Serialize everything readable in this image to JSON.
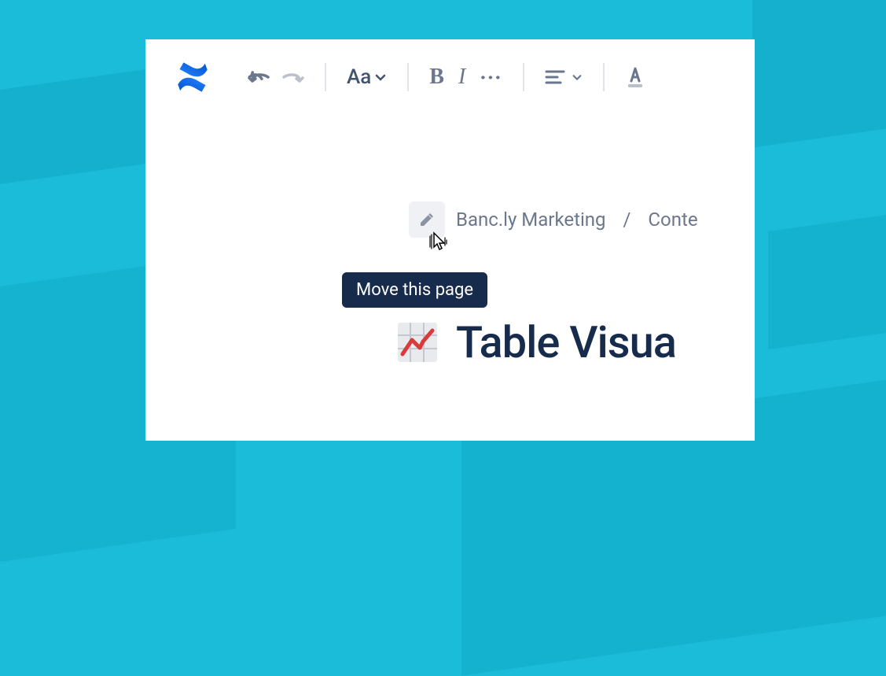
{
  "toolbar": {
    "text_style_label": "Aa",
    "bold_label": "B",
    "italic_label": "I"
  },
  "breadcrumb": {
    "space_name": "Banc.ly Marketing",
    "parent_page": "Conte"
  },
  "tooltip": {
    "move_page": "Move this page"
  },
  "page": {
    "title": "Table Visua"
  },
  "colors": {
    "brand_blue": "#2684ff",
    "text_primary": "#172b4d",
    "text_secondary": "#6b778c",
    "background_teal": "#1bbcd9"
  }
}
